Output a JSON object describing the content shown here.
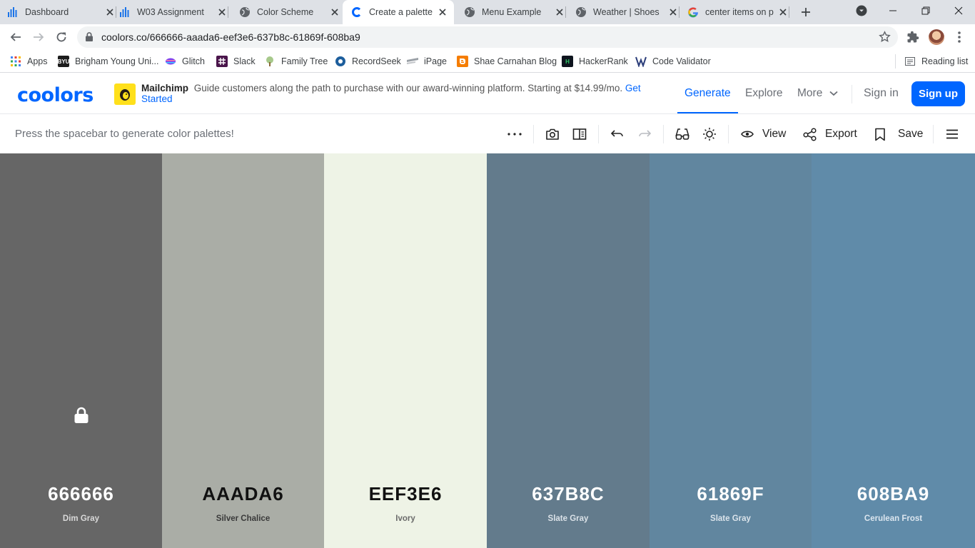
{
  "browser": {
    "tabs": [
      {
        "title": "Dashboard",
        "icon": "bar-chart-icon"
      },
      {
        "title": "W03 Assignment",
        "icon": "bar-chart-icon"
      },
      {
        "title": "Color Scheme",
        "icon": "globe-icon"
      },
      {
        "title": "Create a palette -",
        "icon": "coolors-icon"
      },
      {
        "title": "Menu Example",
        "icon": "globe-icon"
      },
      {
        "title": "Weather | Shoes",
        "icon": "globe-icon"
      },
      {
        "title": "center items on p",
        "icon": "google-icon"
      }
    ],
    "active_tab": 3,
    "url": "coolors.co/666666-aaada6-eef3e6-637b8c-61869f-608ba9",
    "bookmarks": [
      {
        "label": "Apps",
        "color": "#4285f4"
      },
      {
        "label": "Brigham Young Uni...",
        "color": "#1c1c1c",
        "badge": "BYU"
      },
      {
        "label": "Glitch",
        "color": "#7b3ff2"
      },
      {
        "label": "Slack",
        "color": "#4a154b"
      },
      {
        "label": "Family Tree",
        "color": "#8bb173"
      },
      {
        "label": "RecordSeek",
        "color": "#1d5e9c"
      },
      {
        "label": "iPage",
        "color": "#9aa0a6"
      },
      {
        "label": "Shae Carnahan Blog",
        "color": "#f57d00"
      },
      {
        "label": "HackerRank",
        "color": "#0e141e",
        "badge": "H"
      },
      {
        "label": "Code Validator",
        "color": "#2c3e7a"
      }
    ],
    "reading_list": "Reading list"
  },
  "site": {
    "logo": "coolors",
    "ad": {
      "brand": "Mailchimp",
      "text": "Guide customers along the path to purchase with our award-winning platform. Starting at $14.99/mo.",
      "cta": "Get Started"
    },
    "nav": {
      "generate": "Generate",
      "explore": "Explore",
      "more": "More",
      "sign_in": "Sign in",
      "sign_up": "Sign up"
    }
  },
  "toolbar": {
    "hint": "Press the spacebar to generate color palettes!",
    "view": "View",
    "export": "Export",
    "save": "Save"
  },
  "palette": [
    {
      "hex": "666666",
      "name": "Dim Gray",
      "color": "#666666",
      "text_color": "#ffffff",
      "name_color": "#d9d9d9",
      "locked": true
    },
    {
      "hex": "AAADA6",
      "name": "Silver Chalice",
      "color": "#aaada6",
      "text_color": "#111111",
      "name_color": "#3a3a3a",
      "locked": false
    },
    {
      "hex": "EEF3E6",
      "name": "Ivory",
      "color": "#eef3e6",
      "text_color": "#111111",
      "name_color": "#6b6b6b",
      "locked": false
    },
    {
      "hex": "637B8C",
      "name": "Slate Gray",
      "color": "#637b8c",
      "text_color": "#ffffff",
      "name_color": "#dbe2e8",
      "locked": false
    },
    {
      "hex": "61869F",
      "name": "Slate Gray",
      "color": "#61869f",
      "text_color": "#ffffff",
      "name_color": "#dbe4eb",
      "locked": false
    },
    {
      "hex": "608BA9",
      "name": "Cerulean Frost",
      "color": "#608ba9",
      "text_color": "#ffffff",
      "name_color": "#dce6ef",
      "locked": false
    }
  ]
}
